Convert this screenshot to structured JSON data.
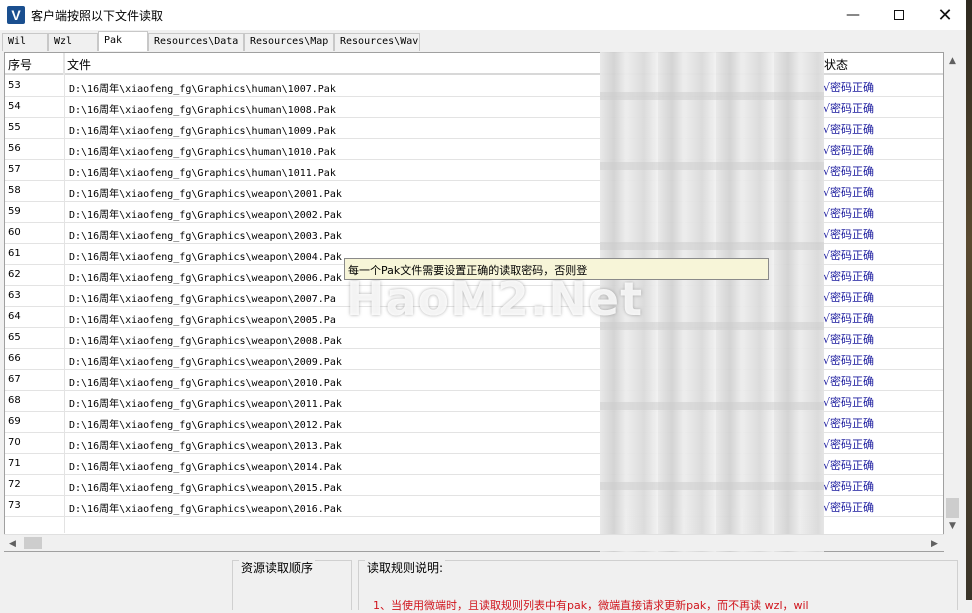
{
  "window": {
    "title": "客户端按照以下文件读取",
    "icon_letter": "V",
    "minimize_label": "—",
    "close_label": "✕"
  },
  "tabs": [
    {
      "label": "Wil"
    },
    {
      "label": "Wzl"
    },
    {
      "label": "Pak",
      "active": true
    },
    {
      "label": "Resources\\Data"
    },
    {
      "label": "Resources\\Map"
    },
    {
      "label": "Resources\\Wav"
    }
  ],
  "table": {
    "columns": {
      "index": "序号",
      "file": "文件",
      "status": "状态"
    },
    "rows": [
      {
        "index": "53",
        "file": "D:\\16周年\\xiaofeng_fg\\Graphics\\human\\1007.Pak",
        "status": "√密码正确"
      },
      {
        "index": "54",
        "file": "D:\\16周年\\xiaofeng_fg\\Graphics\\human\\1008.Pak",
        "status": "√密码正确"
      },
      {
        "index": "55",
        "file": "D:\\16周年\\xiaofeng_fg\\Graphics\\human\\1009.Pak",
        "status": "√密码正确"
      },
      {
        "index": "56",
        "file": "D:\\16周年\\xiaofeng_fg\\Graphics\\human\\1010.Pak",
        "status": "√密码正确"
      },
      {
        "index": "57",
        "file": "D:\\16周年\\xiaofeng_fg\\Graphics\\human\\1011.Pak",
        "status": "√密码正确"
      },
      {
        "index": "58",
        "file": "D:\\16周年\\xiaofeng_fg\\Graphics\\weapon\\2001.Pak",
        "status": "√密码正确"
      },
      {
        "index": "59",
        "file": "D:\\16周年\\xiaofeng_fg\\Graphics\\weapon\\2002.Pak",
        "status": "√密码正确"
      },
      {
        "index": "60",
        "file": "D:\\16周年\\xiaofeng_fg\\Graphics\\weapon\\2003.Pak",
        "status": "√密码正确"
      },
      {
        "index": "61",
        "file": "D:\\16周年\\xiaofeng_fg\\Graphics\\weapon\\2004.Pak",
        "status": "√密码正确"
      },
      {
        "index": "62",
        "file": "D:\\16周年\\xiaofeng_fg\\Graphics\\weapon\\2006.Pak",
        "status": "√密码正确"
      },
      {
        "index": "63",
        "file": "D:\\16周年\\xiaofeng_fg\\Graphics\\weapon\\2007.Pa",
        "status": "√密码正确"
      },
      {
        "index": "64",
        "file": "D:\\16周年\\xiaofeng_fg\\Graphics\\weapon\\2005.Pa",
        "status": "√密码正确"
      },
      {
        "index": "65",
        "file": "D:\\16周年\\xiaofeng_fg\\Graphics\\weapon\\2008.Pak",
        "status": "√密码正确"
      },
      {
        "index": "66",
        "file": "D:\\16周年\\xiaofeng_fg\\Graphics\\weapon\\2009.Pak",
        "status": "√密码正确"
      },
      {
        "index": "67",
        "file": "D:\\16周年\\xiaofeng_fg\\Graphics\\weapon\\2010.Pak",
        "status": "√密码正确"
      },
      {
        "index": "68",
        "file": "D:\\16周年\\xiaofeng_fg\\Graphics\\weapon\\2011.Pak",
        "status": "√密码正确"
      },
      {
        "index": "69",
        "file": "D:\\16周年\\xiaofeng_fg\\Graphics\\weapon\\2012.Pak",
        "status": "√密码正确"
      },
      {
        "index": "70",
        "file": "D:\\16周年\\xiaofeng_fg\\Graphics\\weapon\\2013.Pak",
        "status": "√密码正确"
      },
      {
        "index": "71",
        "file": "D:\\16周年\\xiaofeng_fg\\Graphics\\weapon\\2014.Pak",
        "status": "√密码正确"
      },
      {
        "index": "72",
        "file": "D:\\16周年\\xiaofeng_fg\\Graphics\\weapon\\2015.Pak",
        "status": "√密码正确"
      },
      {
        "index": "73",
        "file": "D:\\16周年\\xiaofeng_fg\\Graphics\\weapon\\2016.Pak",
        "status": "√密码正确"
      }
    ]
  },
  "tooltip": {
    "text": "每一个Pak文件需要设置正确的读取密码，否则登"
  },
  "watermark": {
    "text": "HaoM2.Net"
  },
  "bottom": {
    "order_group_label": "资源读取顺序",
    "rules_group_label": "读取规则说明:",
    "rule_line": "1、当使用微端时，且读取规则列表中有pak，微端直接请求更新pak，而不再读 wzl，wil"
  },
  "colors": {
    "status_text": "#1a1a9e",
    "rule_text": "#d0141c",
    "tooltip_bg": "#f7f5d8"
  }
}
